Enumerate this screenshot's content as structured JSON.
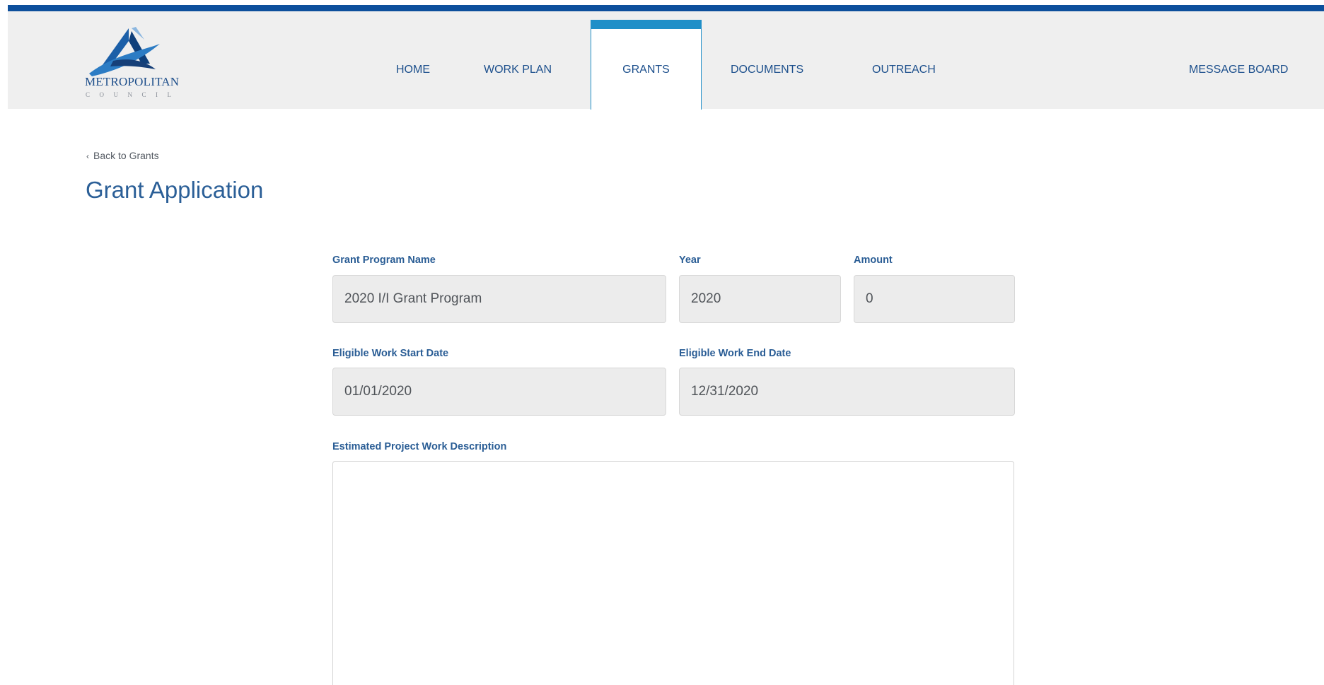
{
  "logo": {
    "name": "METROPOLITAN",
    "sub": "COUNCIL",
    "icon": "metropolitan-council-logo"
  },
  "nav": {
    "items": [
      {
        "label": "HOME"
      },
      {
        "label": "WORK PLAN"
      },
      {
        "label": "GRANTS",
        "active": true
      },
      {
        "label": "DOCUMENTS"
      },
      {
        "label": "OUTREACH"
      },
      {
        "label": "MESSAGE BOARD"
      }
    ]
  },
  "breadcrumb": {
    "chevron_icon": "chevron-left-icon",
    "back_label": "Back to Grants"
  },
  "page": {
    "title": "Grant Application"
  },
  "form": {
    "grant_program_name": {
      "label": "Grant Program Name",
      "value": "2020 I/I Grant Program"
    },
    "year": {
      "label": "Year",
      "value": "2020"
    },
    "amount": {
      "label": "Amount",
      "value": "0"
    },
    "start_date": {
      "label": "Eligible Work Start Date",
      "value": "01/01/2020"
    },
    "end_date": {
      "label": "Eligible Work End Date",
      "value": "12/31/2020"
    },
    "description": {
      "label": "Estimated Project Work Description",
      "value": ""
    }
  },
  "colors": {
    "top_bar": "#0d4f9c",
    "header_bg": "#efefef",
    "active_tab_accent": "#1f8fc8",
    "nav_text": "#1c4f8c",
    "label_text": "#2a5d95",
    "field_bg": "#ececec"
  }
}
